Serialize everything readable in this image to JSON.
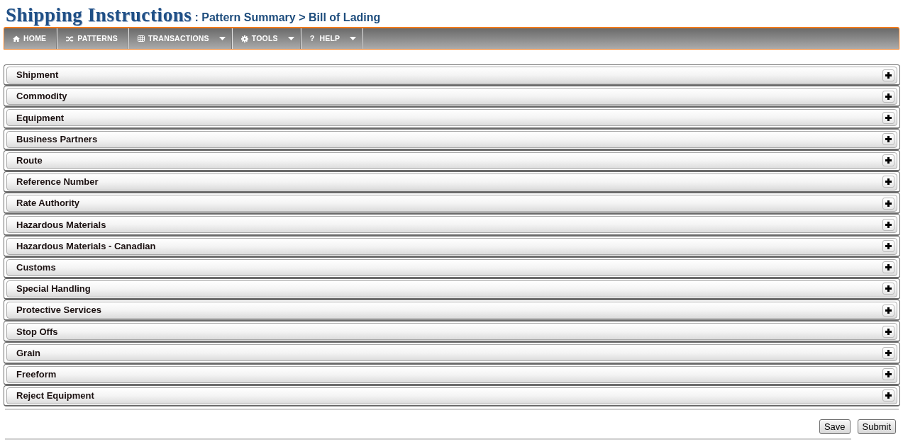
{
  "header": {
    "title": "Shipping Instructions",
    "breadcrumb": ": Pattern Summary > Bill of Lading"
  },
  "nav": [
    {
      "label": "HOME",
      "kind": "home",
      "dropdown": false
    },
    {
      "label": "PATTERNS",
      "kind": "shuffle",
      "dropdown": false
    },
    {
      "label": "TRANSACTIONS",
      "kind": "grid",
      "dropdown": true
    },
    {
      "label": "TOOLS",
      "kind": "gear",
      "dropdown": true
    },
    {
      "label": "HELP",
      "kind": "glyph",
      "glyph": "?",
      "dropdown": true
    }
  ],
  "sections": [
    {
      "label": "Shipment",
      "expanded": false
    },
    {
      "label": "Commodity",
      "expanded": false
    },
    {
      "label": "Equipment",
      "expanded": false
    },
    {
      "label": "Business Partners",
      "expanded": false
    },
    {
      "label": "Route",
      "expanded": false
    },
    {
      "label": "Reference Number",
      "expanded": false
    },
    {
      "label": "Rate Authority",
      "expanded": false
    },
    {
      "label": "Hazardous Materials",
      "expanded": false
    },
    {
      "label": "Hazardous Materials - Canadian",
      "expanded": false
    },
    {
      "label": "Customs",
      "expanded": false
    },
    {
      "label": "Special Handling",
      "expanded": false
    },
    {
      "label": "Protective Services",
      "expanded": false
    },
    {
      "label": "Stop Offs",
      "expanded": false
    },
    {
      "label": "Grain",
      "expanded": false
    },
    {
      "label": "Freeform",
      "expanded": false
    },
    {
      "label": "Reject Equipment",
      "expanded": false
    }
  ],
  "buttons": [
    "Save",
    "Submit"
  ]
}
